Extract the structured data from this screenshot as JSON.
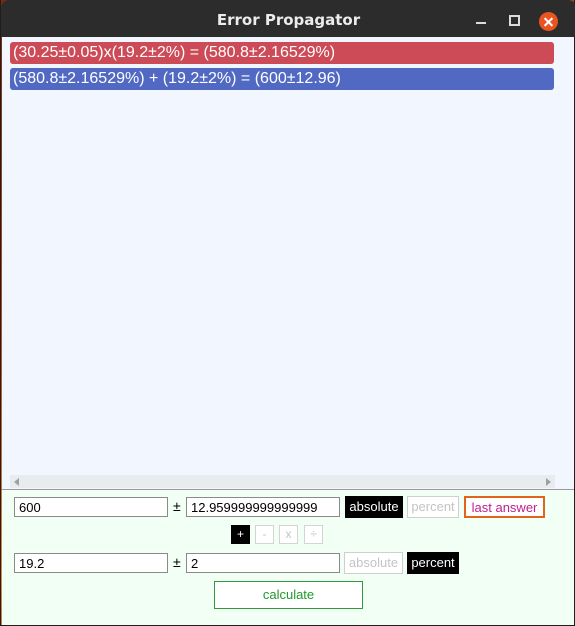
{
  "window": {
    "title": "Error Propagator"
  },
  "history": [
    {
      "text": "(30.25±0.05)x(19.2±2%) = (580.8±2.16529%)",
      "color": "#cd4a57"
    },
    {
      "text": "(580.8±2.16529%) + (19.2±2%) = (600±12.96)",
      "color": "#5169c2"
    }
  ],
  "row1": {
    "value": "600",
    "pm": "±",
    "error": "12.959999999999999",
    "absolute_label": "absolute",
    "percent_label": "percent",
    "mode_selected": "absolute",
    "last_answer_label": "last answer"
  },
  "operations": {
    "plus": "+",
    "minus": "-",
    "times": "x",
    "divide": "÷",
    "selected": "plus"
  },
  "row2": {
    "value": "19.2",
    "pm": "±",
    "error": "2",
    "absolute_label": "absolute",
    "percent_label": "percent",
    "mode_selected": "percent"
  },
  "calculate_label": "calculate",
  "colors": {
    "accent_close": "#e95420",
    "history_red": "#cd4a57",
    "history_blue": "#5169c2",
    "calculate_green": "#1f9a2a",
    "last_answer_border": "#e2641a",
    "last_answer_text": "#c0208a"
  },
  "icons": {
    "minimize": "minimize-icon",
    "maximize": "maximize-icon",
    "close": "close-icon",
    "scroll_left": "scroll-left-icon",
    "scroll_right": "scroll-right-icon"
  }
}
